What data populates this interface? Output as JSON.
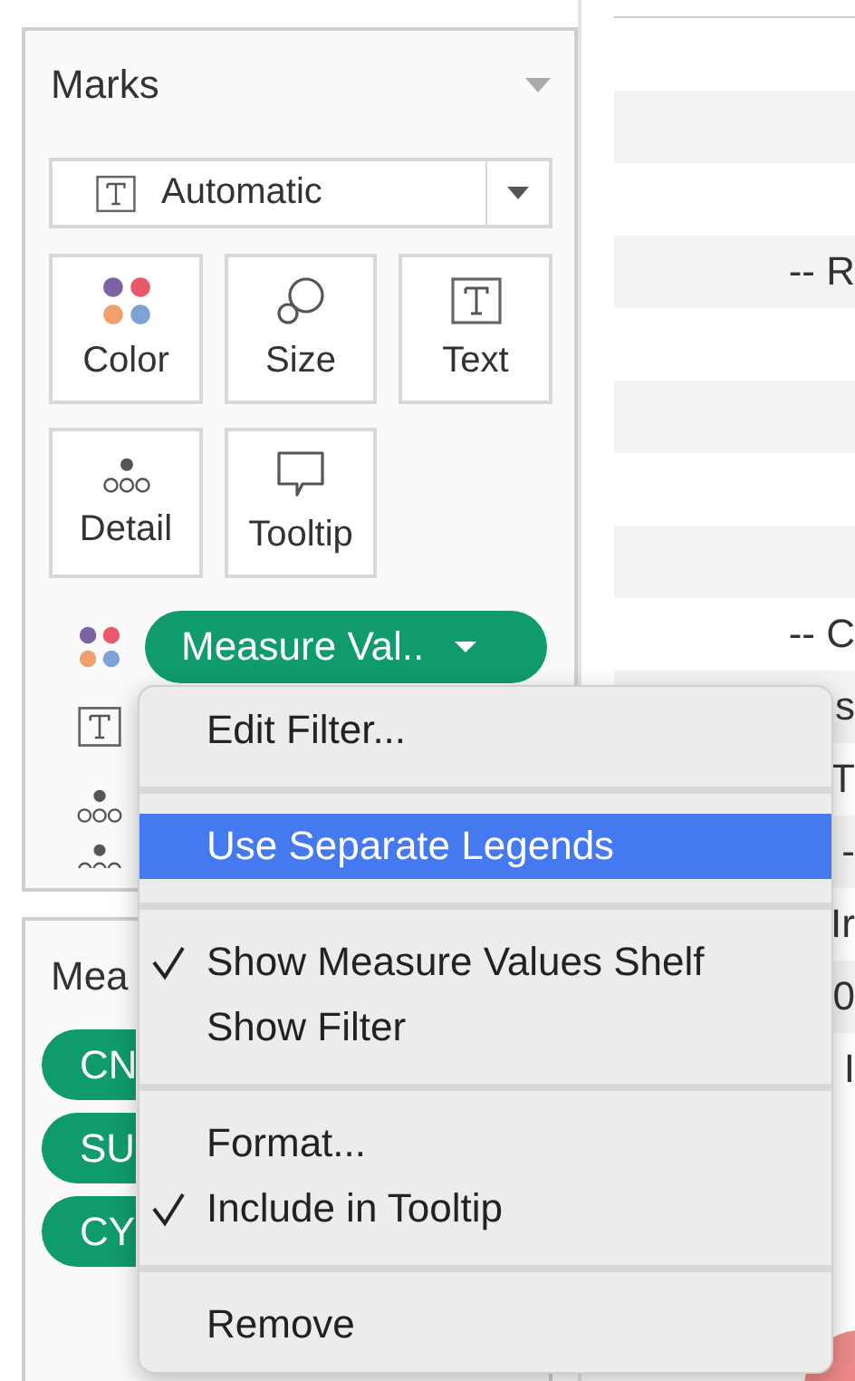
{
  "marks": {
    "title": "Marks",
    "mark_type": "Automatic",
    "buttons": [
      {
        "label": "Color",
        "kind": "color"
      },
      {
        "label": "Size",
        "kind": "size"
      },
      {
        "label": "Text",
        "kind": "text"
      },
      {
        "label": "Detail",
        "kind": "detail"
      },
      {
        "label": "Tooltip",
        "kind": "tooltip"
      }
    ],
    "encodings": [
      {
        "kind": "color",
        "field": "Measure Val.."
      },
      {
        "kind": "text"
      },
      {
        "kind": "detail"
      },
      {
        "kind": "detail"
      }
    ]
  },
  "measure_values": {
    "title": "Mea",
    "pills": [
      "CN",
      "SU",
      "CY"
    ]
  },
  "table": {
    "rows": [
      "",
      "",
      "",
      "-- R",
      "",
      "",
      "",
      "",
      "-- C",
      "s",
      "T",
      "-",
      "Ir",
      "0",
      "I"
    ]
  },
  "context_menu": [
    {
      "kind": "item",
      "label": "Edit Filter...",
      "checked": false,
      "selected": false
    },
    {
      "kind": "separator"
    },
    {
      "kind": "item",
      "label": "Use Separate Legends",
      "checked": false,
      "selected": true
    },
    {
      "kind": "separator"
    },
    {
      "kind": "item",
      "label": "Show Measure Values Shelf",
      "checked": true,
      "selected": false
    },
    {
      "kind": "item",
      "label": "Show Filter",
      "checked": false,
      "selected": false
    },
    {
      "kind": "separator"
    },
    {
      "kind": "item",
      "label": "Format...",
      "checked": false,
      "selected": false
    },
    {
      "kind": "item",
      "label": "Include in Tooltip",
      "checked": true,
      "selected": false
    },
    {
      "kind": "separator"
    },
    {
      "kind": "item",
      "label": "Remove",
      "checked": false,
      "selected": false
    }
  ]
}
